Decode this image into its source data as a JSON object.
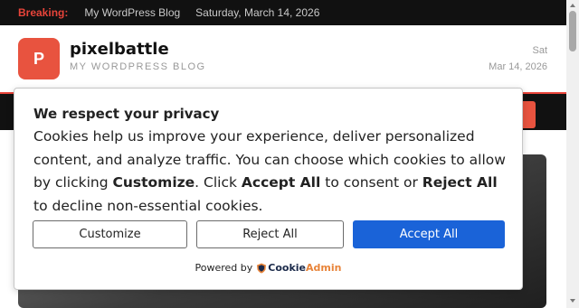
{
  "topbar": {
    "breaking_label": "Breaking:",
    "site_link": "My WordPress Blog",
    "date": "Saturday, March 14, 2026"
  },
  "header": {
    "logo_letter": "P",
    "site_title": "pixelbattle",
    "tagline": "MY WORDPRESS BLOG",
    "day": "Sat",
    "date": "Mar 14, 2026"
  },
  "consent": {
    "title": "We respect your privacy",
    "body_part1": "Cookies help us improve your experience, deliver personalized content, and analyze traffic. You can choose which cookies to allow by clicking ",
    "body_customize": "Customize",
    "body_part2": ". Click ",
    "body_accept": "Accept All",
    "body_part3": " to consent or ",
    "body_reject": "Reject All",
    "body_part4": " to decline non-essential cookies.",
    "customize_label": "Customize",
    "reject_label": "Reject All",
    "accept_label": "Accept All",
    "powered_by": "Powered by",
    "brand_cookie": "Cookie",
    "brand_admin": "Admin"
  },
  "colors": {
    "accent": "#e8443a",
    "accept_button": "#1a63d8",
    "topbar_bg": "#111111"
  },
  "icons": [
    "scroll-up-arrow",
    "scroll-down-arrow",
    "cookieadmin-shield-logo"
  ]
}
